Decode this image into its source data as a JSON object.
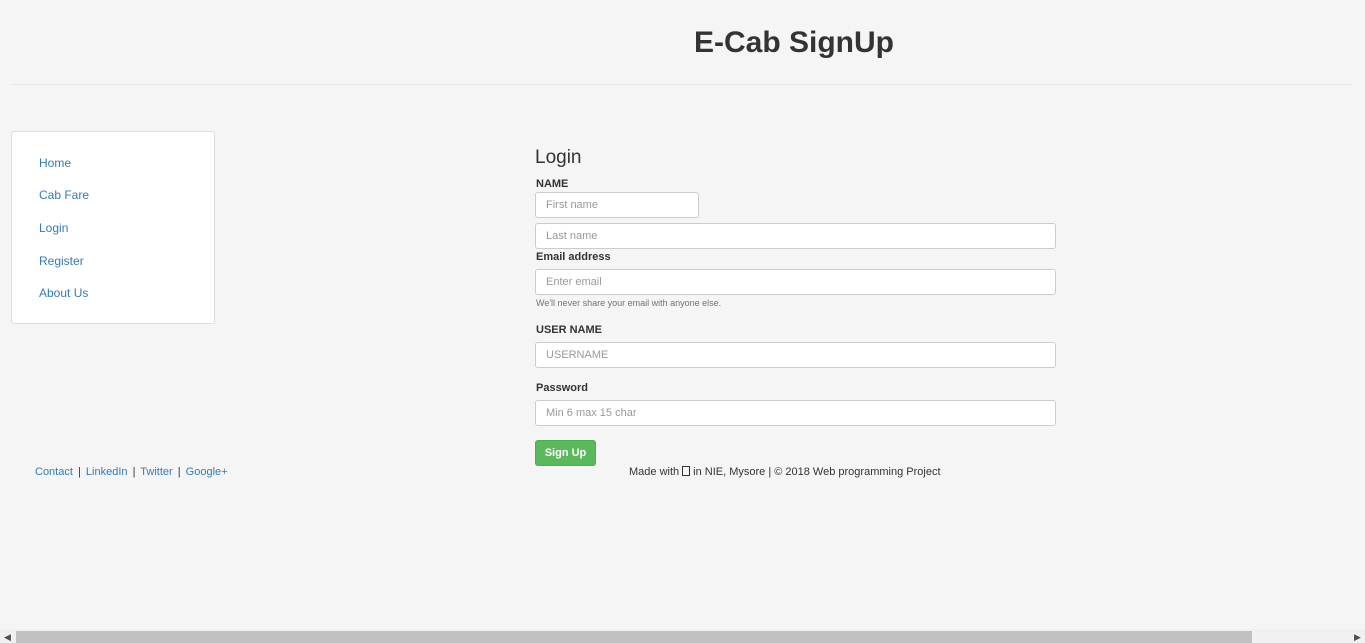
{
  "header": {
    "title": "E-Cab SignUp"
  },
  "sidebar": {
    "items": [
      {
        "label": "Home"
      },
      {
        "label": "Cab Fare"
      },
      {
        "label": "Login"
      },
      {
        "label": "Register"
      },
      {
        "label": "About Us"
      }
    ]
  },
  "form": {
    "heading": "Login",
    "name_label": "NAME",
    "first_name_placeholder": "First name",
    "last_name_placeholder": "Last name",
    "email_label": "Email address",
    "email_placeholder": "Enter email",
    "email_help": "We'll never share your email with anyone else.",
    "username_label": "USER NAME",
    "username_placeholder": "USERNAME",
    "password_label": "Password",
    "password_placeholder": "Min 6 max 15 char",
    "submit_label": "Sign Up"
  },
  "footer": {
    "links": [
      "Contact",
      "LinkedIn",
      "Twitter",
      "Google+"
    ],
    "separator": "|",
    "credit_before": "Made with",
    "credit_after": "in NIE, Mysore | © 2018 Web programming Project"
  },
  "colors": {
    "accent": "#5cb85c",
    "link": "#337ab7",
    "background": "#f5f5f5"
  }
}
